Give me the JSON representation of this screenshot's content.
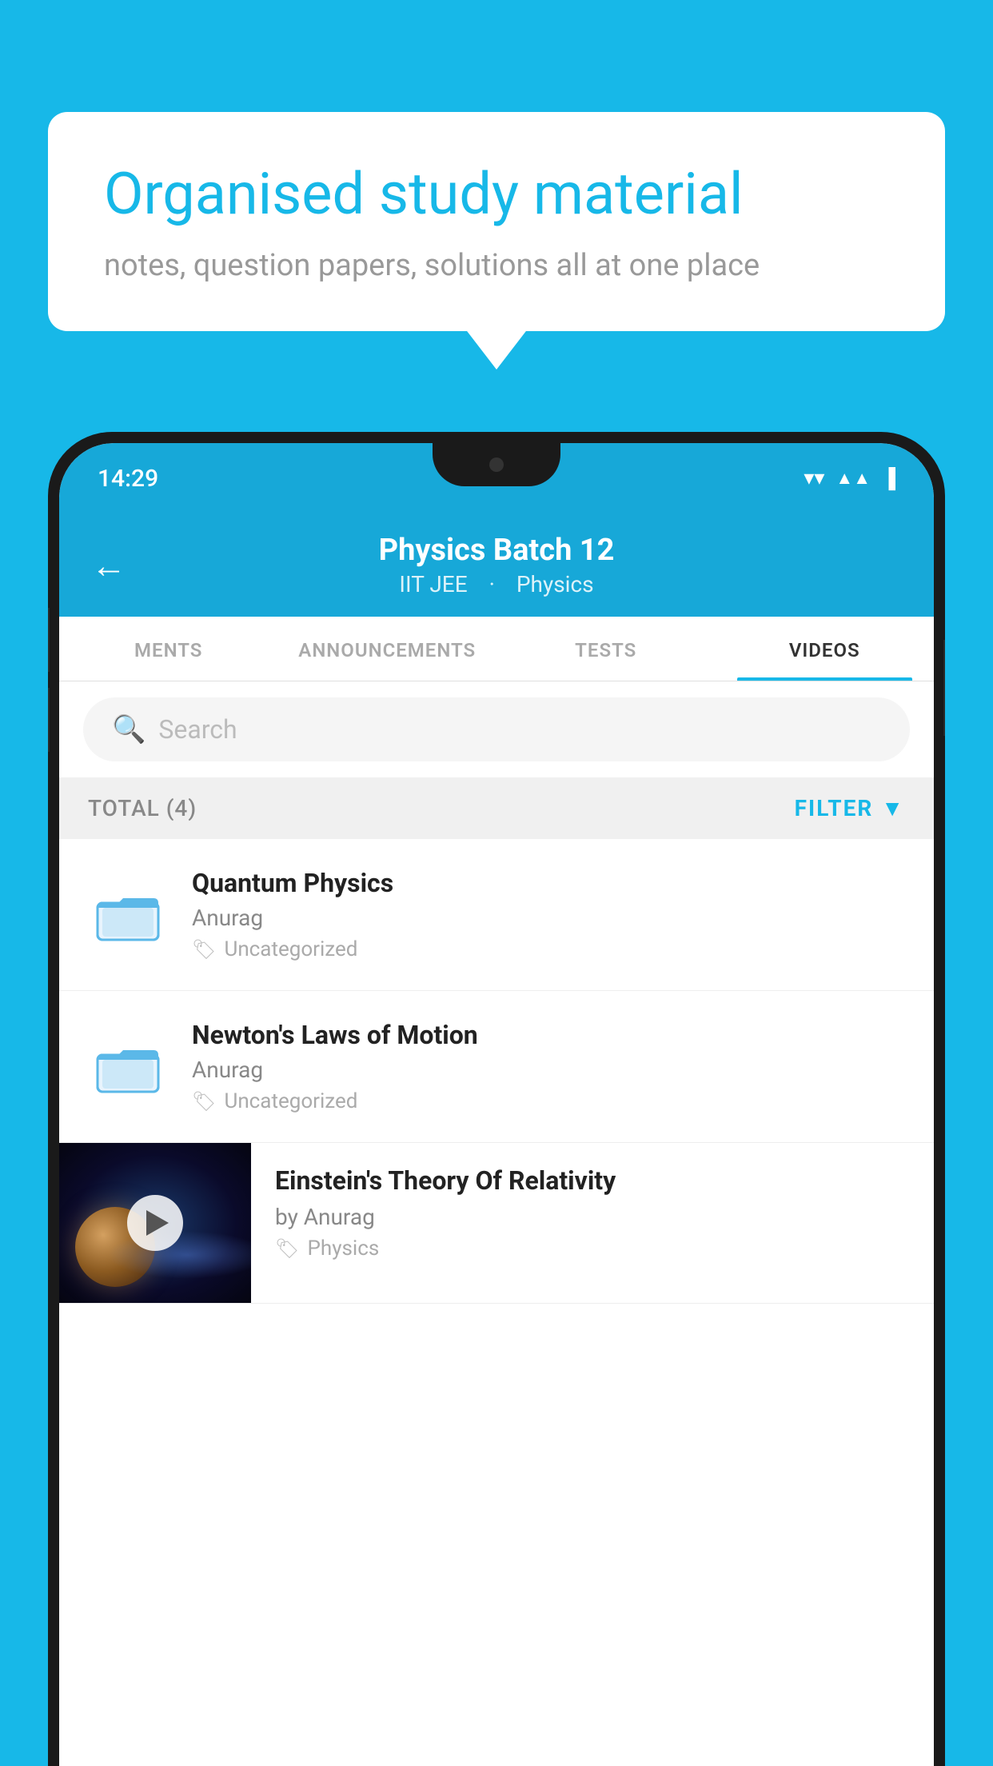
{
  "background_color": "#17b8e8",
  "speech_bubble": {
    "heading": "Organised study material",
    "subtext": "notes, question papers, solutions all at one place"
  },
  "phone": {
    "status_bar": {
      "time": "14:29",
      "icons": [
        "wifi",
        "signal",
        "battery"
      ]
    },
    "header": {
      "back_label": "←",
      "title": "Physics Batch 12",
      "subtitle_parts": [
        "IIT JEE",
        "Physics"
      ]
    },
    "tabs": [
      {
        "label": "MENTS",
        "active": false
      },
      {
        "label": "ANNOUNCEMENTS",
        "active": false
      },
      {
        "label": "TESTS",
        "active": false
      },
      {
        "label": "VIDEOS",
        "active": true
      }
    ],
    "search": {
      "placeholder": "Search"
    },
    "filter": {
      "total_label": "TOTAL (4)",
      "filter_label": "FILTER"
    },
    "videos": [
      {
        "type": "folder",
        "title": "Quantum Physics",
        "author": "Anurag",
        "tag": "Uncategorized"
      },
      {
        "type": "folder",
        "title": "Newton's Laws of Motion",
        "author": "Anurag",
        "tag": "Uncategorized"
      },
      {
        "type": "thumbnail",
        "title": "Einstein's Theory Of Relativity",
        "author": "by Anurag",
        "tag": "Physics"
      }
    ]
  }
}
